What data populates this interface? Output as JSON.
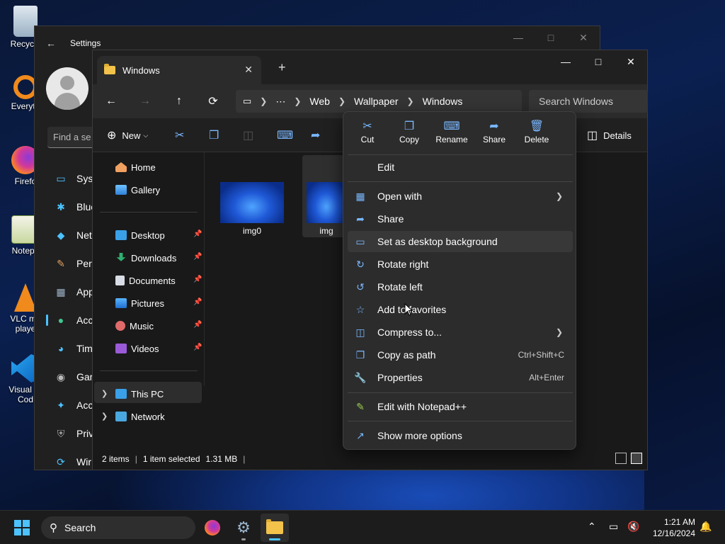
{
  "desktop": {
    "icons": [
      {
        "label": "Recycle"
      },
      {
        "label": "Everyth"
      },
      {
        "label": "Firefo"
      },
      {
        "label": "Notepa"
      },
      {
        "label": "VLC me",
        "label2": "playe"
      },
      {
        "label": "Visual St",
        "label2": "Cod"
      }
    ]
  },
  "settings": {
    "title": "Settings",
    "find_placeholder": "Find a se",
    "nav": [
      {
        "label": "Syst",
        "icon": "monitor-icon",
        "color": "#4cc2ff"
      },
      {
        "label": "Blue",
        "icon": "bluetooth-icon",
        "color": "#4cc2ff"
      },
      {
        "label": "Net",
        "icon": "wifi-icon",
        "color": "#4cc2ff"
      },
      {
        "label": "Pers",
        "icon": "brush-icon",
        "color": "#e0a060"
      },
      {
        "label": "App",
        "icon": "apps-icon",
        "color": "#9fb4c8"
      },
      {
        "label": "Acc",
        "icon": "person-icon",
        "color": "#40c890"
      },
      {
        "label": "Tim",
        "icon": "globe-clock-icon",
        "color": "#4cc2ff"
      },
      {
        "label": "Gar",
        "icon": "gamepad-icon",
        "color": "#bbbbbb"
      },
      {
        "label": "Acc",
        "icon": "accessibility-icon",
        "color": "#4cc2ff"
      },
      {
        "label": "Priv",
        "icon": "shield-icon",
        "color": "#aaaaaa"
      },
      {
        "label": "Wir",
        "icon": "update-icon",
        "color": "#4cc2ff"
      }
    ]
  },
  "explorer": {
    "tab_title": "Windows",
    "breadcrumb": [
      "Web",
      "Wallpaper",
      "Windows"
    ],
    "search_placeholder": "Search Windows",
    "new_label": "New",
    "details_label": "Details",
    "nav": {
      "home": "Home",
      "gallery": "Gallery",
      "quick": [
        "Desktop",
        "Downloads",
        "Documents",
        "Pictures",
        "Music",
        "Videos"
      ],
      "this_pc": "This PC",
      "network": "Network"
    },
    "files": [
      {
        "name": "img0"
      },
      {
        "name": "img"
      }
    ],
    "status": {
      "items": "2 items",
      "selected": "1 item selected",
      "size": "1.31 MB"
    }
  },
  "context_menu": {
    "top_actions": [
      "Cut",
      "Copy",
      "Rename",
      "Share",
      "Delete"
    ],
    "items": [
      {
        "label": "Edit"
      },
      {
        "label": "Open with"
      },
      {
        "label": "Share"
      },
      {
        "label": "Set as desktop background"
      },
      {
        "label": "Rotate right"
      },
      {
        "label": "Rotate left"
      },
      {
        "label": "Add to favorites"
      },
      {
        "label": "Compress to..."
      },
      {
        "label": "Copy as path",
        "shortcut": "Ctrl+Shift+C"
      },
      {
        "label": "Properties",
        "shortcut": "Alt+Enter"
      },
      {
        "label": "Edit with Notepad++"
      },
      {
        "label": "Show more options"
      }
    ]
  },
  "taskbar": {
    "search_label": "Search",
    "time": "1:21 AM",
    "date": "12/16/2024"
  },
  "colors": {
    "accent": "#4cc2ff",
    "menu_bg": "#2c2c2c",
    "explorer_bg": "#191919"
  }
}
